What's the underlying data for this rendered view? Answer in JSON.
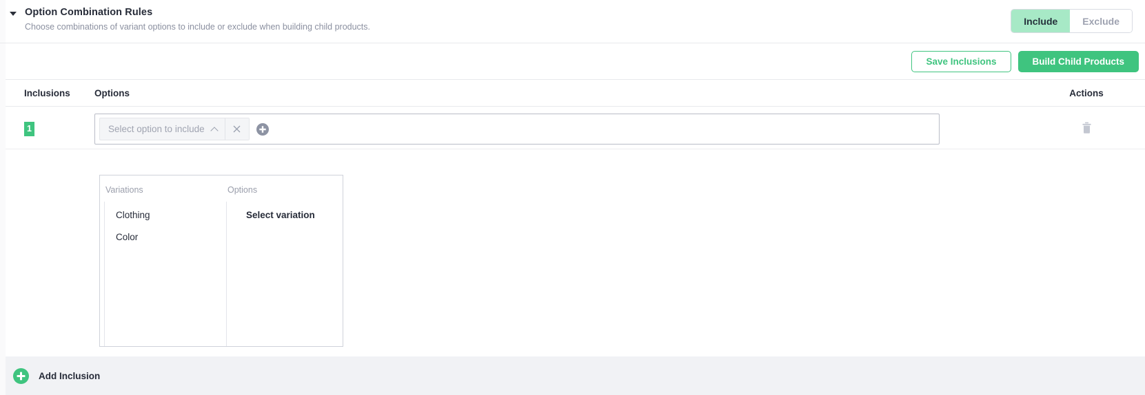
{
  "header": {
    "title": "Option Combination Rules",
    "subtitle": "Choose combinations of variant options to include or exclude when building child products.",
    "caret_icon": "caret-down-icon",
    "mode_toggle": {
      "include_label": "Include",
      "exclude_label": "Exclude",
      "selected": "Include",
      "active_bg": "#a7e9c6"
    }
  },
  "action_bar": {
    "save_label": "Save Inclusions",
    "build_label": "Build Child Products",
    "accent": "#3fc47f"
  },
  "table": {
    "columns": {
      "inclusions": "Inclusions",
      "options": "Options",
      "actions": "Actions"
    },
    "rows": [
      {
        "index_badge": "1",
        "badge_color": "#3fc47f",
        "select_placeholder": "Select option to include",
        "chevron_icon": "chevron-up-icon",
        "clear_icon": "close-icon",
        "add_option_icon": "plus-circle-icon",
        "delete_icon": "trash-icon"
      }
    ]
  },
  "dropdown": {
    "open": true,
    "variations_title": "Variations",
    "options_title": "Options",
    "variations": [
      {
        "label": "Clothing"
      },
      {
        "label": "Color"
      }
    ],
    "options_placeholder": "Select variation"
  },
  "footer": {
    "add_inclusion_label": "Add Inclusion",
    "add_icon": "plus-circle-icon",
    "background": "#f1f2f5"
  }
}
